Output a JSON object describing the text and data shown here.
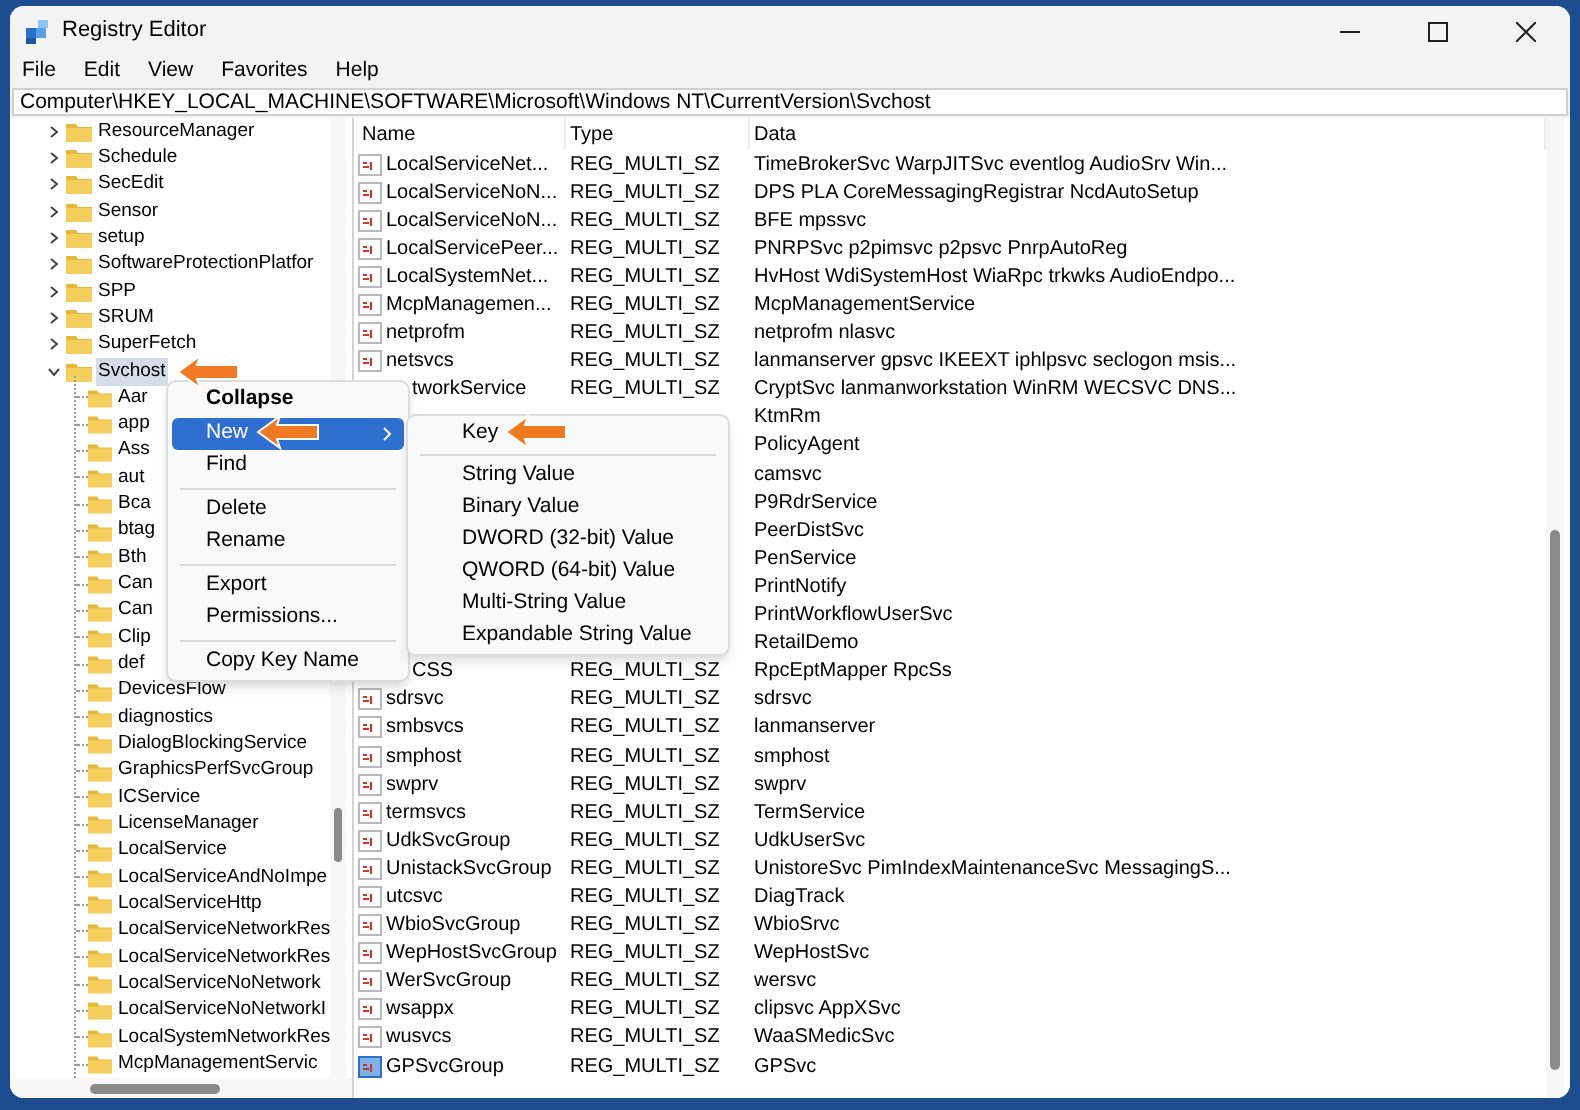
{
  "window": {
    "title": "Registry Editor"
  },
  "menu_bar": [
    "File",
    "Edit",
    "View",
    "Favorites",
    "Help"
  ],
  "address": "Computer\\HKEY_LOCAL_MACHINE\\SOFTWARE\\Microsoft\\Windows NT\\CurrentVersion\\Svchost",
  "tree": [
    {
      "label": "ResourceManager",
      "expanded": false,
      "selected": false
    },
    {
      "label": "Schedule",
      "expanded": false,
      "selected": false
    },
    {
      "label": "SecEdit",
      "expanded": false,
      "selected": false
    },
    {
      "label": "Sensor",
      "expanded": false,
      "selected": false
    },
    {
      "label": "setup",
      "expanded": false,
      "selected": false
    },
    {
      "label": "SoftwareProtectionPlatfor",
      "expanded": false,
      "selected": false
    },
    {
      "label": "SPP",
      "expanded": false,
      "selected": false
    },
    {
      "label": "SRUM",
      "expanded": false,
      "selected": false
    },
    {
      "label": "SuperFetch",
      "expanded": false,
      "selected": false
    },
    {
      "label": "Svchost",
      "expanded": true,
      "selected": true,
      "children": [
        {
          "label": "Aar",
          "selected": false
        },
        {
          "label": "app",
          "selected": false
        },
        {
          "label": "Ass",
          "selected": false
        },
        {
          "label": "aut",
          "selected": false
        },
        {
          "label": "Bca",
          "selected": false
        },
        {
          "label": "btag",
          "selected": false
        },
        {
          "label": "Bth",
          "selected": false
        },
        {
          "label": "Can",
          "selected": false
        },
        {
          "label": "Can",
          "selected": false
        },
        {
          "label": "Clip",
          "selected": false
        },
        {
          "label": "def",
          "selected": false
        },
        {
          "label": "DevicesFlow",
          "selected": false
        },
        {
          "label": "diagnostics",
          "selected": false
        },
        {
          "label": "DialogBlockingService",
          "selected": false
        },
        {
          "label": "GraphicsPerfSvcGroup",
          "selected": false
        },
        {
          "label": "ICService",
          "selected": false
        },
        {
          "label": "LicenseManager",
          "selected": false
        },
        {
          "label": "LocalService",
          "selected": false
        },
        {
          "label": "LocalServiceAndNoImpe",
          "selected": false
        },
        {
          "label": "LocalServiceHttp",
          "selected": false
        },
        {
          "label": "LocalServiceNetworkRes",
          "selected": false
        },
        {
          "label": "LocalServiceNetworkRes",
          "selected": false
        },
        {
          "label": "LocalServiceNoNetwork",
          "selected": false
        },
        {
          "label": "LocalServiceNoNetworkI",
          "selected": false
        },
        {
          "label": "LocalSystemNetworkRes",
          "selected": false
        },
        {
          "label": "McpManagementServic",
          "selected": false
        }
      ]
    }
  ],
  "values": {
    "columns": [
      "Name",
      "Type",
      "Data"
    ],
    "rows": [
      {
        "name": "LocalServiceNet...",
        "icon": true,
        "selected": false,
        "type": "REG_MULTI_SZ",
        "data": "TimeBrokerSvc WarpJITSvc eventlog AudioSrv Win..."
      },
      {
        "name": "LocalServiceNoN...",
        "icon": true,
        "selected": false,
        "type": "REG_MULTI_SZ",
        "data": "DPS PLA CoreMessagingRegistrar NcdAutoSetup"
      },
      {
        "name": "LocalServiceNoN...",
        "icon": true,
        "selected": false,
        "type": "REG_MULTI_SZ",
        "data": "BFE mpssvc"
      },
      {
        "name": "LocalServicePeer...",
        "icon": true,
        "selected": false,
        "type": "REG_MULTI_SZ",
        "data": "PNRPSvc p2pimsvc p2psvc PnrpAutoReg"
      },
      {
        "name": "LocalSystemNet...",
        "icon": true,
        "selected": false,
        "type": "REG_MULTI_SZ",
        "data": "HvHost WdiSystemHost WiaRpc trkwks AudioEndpo..."
      },
      {
        "name": "McpManagemen...",
        "icon": true,
        "selected": false,
        "type": "REG_MULTI_SZ",
        "data": "McpManagementService"
      },
      {
        "name": "netprofm",
        "icon": true,
        "selected": false,
        "type": "REG_MULTI_SZ",
        "data": "netprofm nlasvc"
      },
      {
        "name": "netsvcs",
        "icon": true,
        "selected": false,
        "type": "REG_MULTI_SZ",
        "data": "lanmanserver gpsvc IKEEXT iphlpsvc seclogon msis..."
      },
      {
        "name": "tworkService",
        "icon": false,
        "selected": false,
        "type": "REG_MULTI_SZ",
        "data": "CryptSvc lanmanworkstation WinRM WECSVC DNS..."
      },
      {
        "data": "KtmRm"
      },
      {
        "data": "PolicyAgent"
      },
      {
        "data": "camsvc"
      },
      {
        "data": "P9RdrService"
      },
      {
        "data": "PeerDistSvc"
      },
      {
        "data": "PenService"
      },
      {
        "data": "PrintNotify"
      },
      {
        "data": "PrintWorkflowUserSvc"
      },
      {
        "data": "RetailDemo"
      },
      {
        "name": "CSS",
        "icon": false,
        "selected": false,
        "type": "REG_MULTI_SZ",
        "data": "RpcEptMapper RpcSs"
      },
      {
        "name": "sdrsvc",
        "icon": true,
        "selected": false,
        "type": "REG_MULTI_SZ",
        "data": "sdrsvc"
      },
      {
        "name": "smbsvcs",
        "icon": true,
        "selected": false,
        "type": "REG_MULTI_SZ",
        "data": "lanmanserver"
      },
      {
        "name": "smphost",
        "icon": true,
        "selected": false,
        "type": "REG_MULTI_SZ",
        "data": "smphost"
      },
      {
        "name": "swprv",
        "icon": true,
        "selected": false,
        "type": "REG_MULTI_SZ",
        "data": "swprv"
      },
      {
        "name": "termsvcs",
        "icon": true,
        "selected": false,
        "type": "REG_MULTI_SZ",
        "data": "TermService"
      },
      {
        "name": "UdkSvcGroup",
        "icon": true,
        "selected": false,
        "type": "REG_MULTI_SZ",
        "data": "UdkUserSvc"
      },
      {
        "name": "UnistackSvcGroup",
        "icon": true,
        "selected": false,
        "type": "REG_MULTI_SZ",
        "data": "UnistoreSvc PimIndexMaintenanceSvc MessagingS..."
      },
      {
        "name": "utcsvc",
        "icon": true,
        "selected": false,
        "type": "REG_MULTI_SZ",
        "data": "DiagTrack"
      },
      {
        "name": "WbioSvcGroup",
        "icon": true,
        "selected": false,
        "type": "REG_MULTI_SZ",
        "data": "WbioSrvc"
      },
      {
        "name": "WepHostSvcGroup",
        "icon": true,
        "selected": false,
        "type": "REG_MULTI_SZ",
        "data": "WepHostSvc"
      },
      {
        "name": "WerSvcGroup",
        "icon": true,
        "selected": false,
        "type": "REG_MULTI_SZ",
        "data": "wersvc"
      },
      {
        "name": "wsappx",
        "icon": true,
        "selected": false,
        "type": "REG_MULTI_SZ",
        "data": "clipsvc AppXSvc"
      },
      {
        "name": "wusvcs",
        "icon": true,
        "selected": false,
        "type": "REG_MULTI_SZ",
        "data": "WaaSMedicSvc"
      },
      {
        "name": "GPSvcGroup",
        "icon": true,
        "selected": true,
        "type": "REG_MULTI_SZ",
        "data": "GPSvc"
      }
    ]
  },
  "context_menu": {
    "items": [
      {
        "kind": "item",
        "label": "Collapse",
        "default": true,
        "selected": false,
        "submenu": false
      },
      {
        "kind": "item",
        "label": "New",
        "default": false,
        "selected": true,
        "submenu": true
      },
      {
        "kind": "item",
        "label": "Find",
        "default": false,
        "selected": false,
        "submenu": false
      },
      {
        "kind": "separator"
      },
      {
        "kind": "item",
        "label": "Delete",
        "default": false,
        "selected": false,
        "submenu": false
      },
      {
        "kind": "item",
        "label": "Rename",
        "default": false,
        "selected": false,
        "submenu": false
      },
      {
        "kind": "separator"
      },
      {
        "kind": "item",
        "label": "Export",
        "default": false,
        "selected": false,
        "submenu": false
      },
      {
        "kind": "item",
        "label": "Permissions...",
        "default": false,
        "selected": false,
        "submenu": false
      },
      {
        "kind": "separator"
      },
      {
        "kind": "item",
        "label": "Copy Key Name",
        "default": false,
        "selected": false,
        "submenu": false
      }
    ]
  },
  "submenu": {
    "items": [
      {
        "kind": "item",
        "label": "Key",
        "selected": false
      },
      {
        "kind": "separator"
      },
      {
        "kind": "item",
        "label": "String Value",
        "selected": false
      },
      {
        "kind": "item",
        "label": "Binary Value",
        "selected": false
      },
      {
        "kind": "item",
        "label": "DWORD (32-bit) Value",
        "selected": false
      },
      {
        "kind": "item",
        "label": "QWORD (64-bit) Value",
        "selected": false
      },
      {
        "kind": "item",
        "label": "Multi-String Value",
        "selected": false
      },
      {
        "kind": "item",
        "label": "Expandable String Value",
        "selected": false
      }
    ]
  }
}
